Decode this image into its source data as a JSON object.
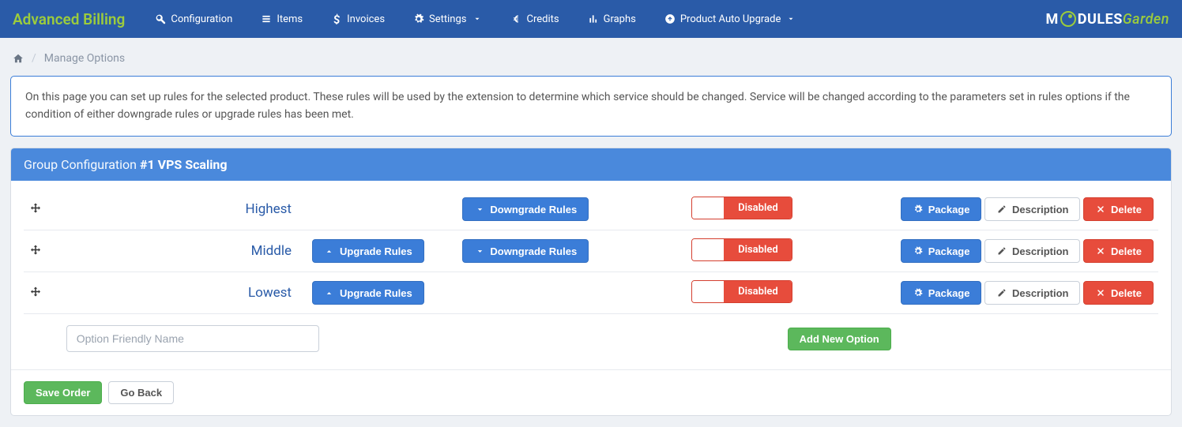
{
  "brand": "Advanced Billing",
  "nav": {
    "configuration": "Configuration",
    "items": "Items",
    "invoices": "Invoices",
    "settings": "Settings",
    "credits": "Credits",
    "graphs": "Graphs",
    "product_auto_upgrade": "Product Auto Upgrade"
  },
  "logo": {
    "modules": "M",
    "odules": "DULES",
    "garden": "Garden"
  },
  "breadcrumb": {
    "current": "Manage Options"
  },
  "info": "On this page you can set up rules for the selected product. These rules will be used by the extension to determine which service should be changed. Service will be changed according to the parameters set in rules options if the condition of either downgrade rules or upgrade rules has been met.",
  "panel": {
    "title_prefix": "Group Configuration",
    "title_bold": "#1 VPS Scaling"
  },
  "labels": {
    "upgrade_rules": "Upgrade Rules",
    "downgrade_rules": "Downgrade Rules",
    "disabled": "Disabled",
    "package": "Package",
    "description": "Description",
    "delete": "Delete",
    "add_new_option": "Add New Option",
    "option_placeholder": "Option Friendly Name",
    "save_order": "Save Order",
    "go_back": "Go Back"
  },
  "rows": [
    {
      "name": "Highest",
      "show_upgrade": false,
      "show_downgrade": true,
      "status": "Disabled"
    },
    {
      "name": "Middle",
      "show_upgrade": true,
      "show_downgrade": true,
      "status": "Disabled"
    },
    {
      "name": "Lowest",
      "show_upgrade": true,
      "show_downgrade": false,
      "status": "Disabled"
    }
  ]
}
